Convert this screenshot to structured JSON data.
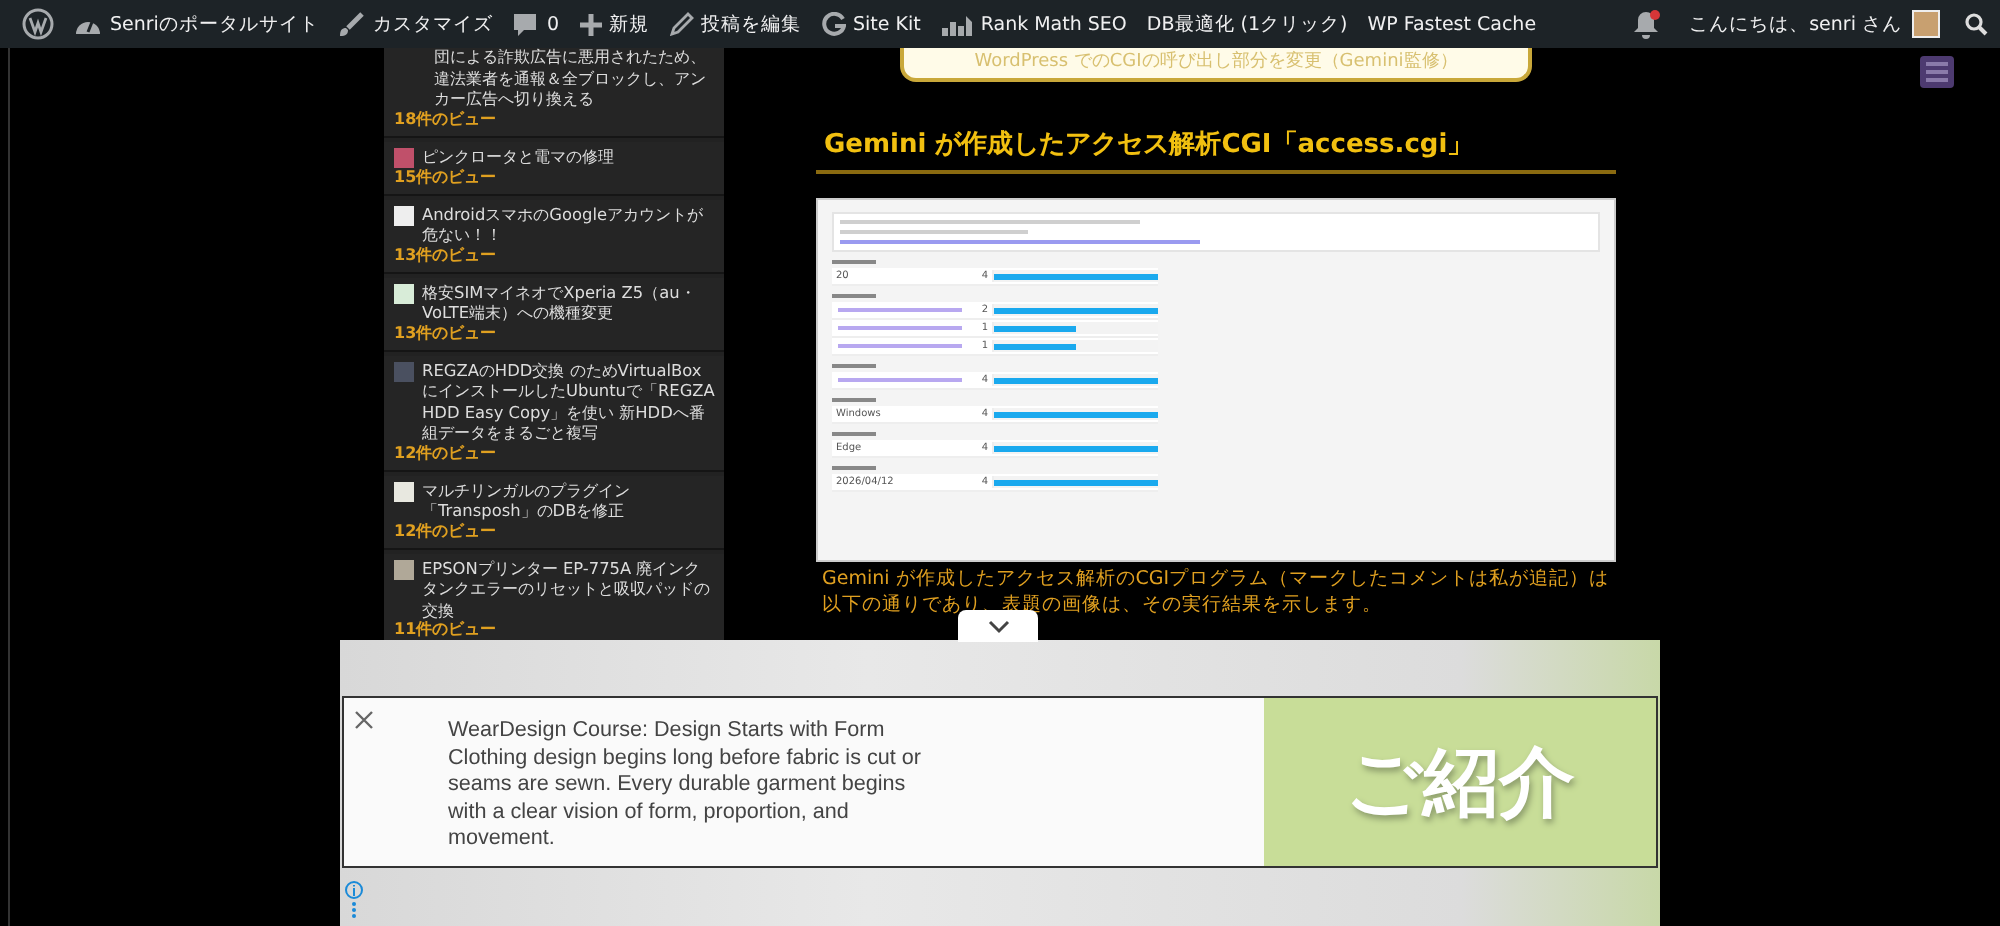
{
  "admin_bar": {
    "items": [
      {
        "kind": "wp"
      },
      {
        "kind": "site",
        "label": "Senriのポータルサイト"
      },
      {
        "kind": "brush",
        "label": "カスタマイズ"
      },
      {
        "kind": "comment",
        "label": "0"
      },
      {
        "kind": "plus",
        "label": "新規"
      },
      {
        "kind": "pencil",
        "label": "投稿を編集"
      },
      {
        "kind": "g",
        "label": "Site Kit"
      },
      {
        "kind": "chart",
        "label": "Rank Math SEO"
      },
      {
        "kind": "none",
        "label": "DB最適化 (1クリック)"
      },
      {
        "kind": "none",
        "label": "WP Fastest Cache"
      }
    ],
    "notification": true,
    "greeting": "こんにちは、senri さん"
  },
  "sidebar": {
    "items": [
      {
        "title": "団による詐欺広告に悪用されたため、違法業者を通報＆全ブロックし、アンカー広告へ切り換える",
        "views": "18件のビュー"
      },
      {
        "title": "ピンクロータと電マの修理",
        "views": "15件のビュー",
        "color": "#c0506a"
      },
      {
        "title": "AndroidスマホのGoogleアカウントが危ない！！",
        "views": "13件のビュー",
        "color": "#eeeeee"
      },
      {
        "title": "格安SIMマイネオでXperia Z5（au・VoLTE端末）への機種変更",
        "views": "13件のビュー",
        "color": "#d8ecd8"
      },
      {
        "title": "REGZAのHDD交換 のためVirtualBoxにインストールしたUbuntuで「REGZA HDD Easy Copy」を使い 新HDDへ番組データをまるごと複写",
        "views": "12件のビュー",
        "color": "#4a5060"
      },
      {
        "title": "マルチリンガルのプラグイン「Transposh」のDBを修正",
        "views": "12件のビュー",
        "color": "#e8e8e0"
      },
      {
        "title": "EPSONプリンター EP-775A 廃インクタンクエラーのリセットと吸収パッドの交換",
        "views": "11件のビュー",
        "color": "#b0a898"
      }
    ]
  },
  "article": {
    "prev_box": "WordPress でのCGIの呼び出し部分を変更（Gemini監修）",
    "heading": "Gemini が作成したアクセス解析CGI「access.cgi」",
    "screenshot": {
      "sections": [
        {
          "rows": [
            {
              "label": "20",
              "count": "4",
              "level": 1
            }
          ]
        },
        {
          "rows": [
            {
              "count": "2",
              "level": 1
            },
            {
              "count": "1",
              "level": 0.5
            },
            {
              "count": "1",
              "level": 0.5
            }
          ]
        },
        {
          "rows": [
            {
              "count": "4",
              "level": 1
            }
          ]
        },
        {
          "rows": [
            {
              "label": "Windows",
              "count": "4",
              "level": 1
            }
          ]
        },
        {
          "rows": [
            {
              "label": "Edge",
              "count": "4",
              "level": 1
            }
          ]
        },
        {
          "rows": [
            {
              "label": "2026/04/12",
              "count": "4",
              "level": 1
            }
          ]
        }
      ]
    },
    "paragraph": "Gemini が作成したアクセス解析のCGIプログラム（マークしたコメントは私が追記）は以下の通りであり、表題の画像は、その実行結果を示します。"
  },
  "ad": {
    "title": "WearDesign Course: Design Starts with Form",
    "body": "Clothing design begins long before fabric is cut or seams are sewn. Every durable garment begins with a clear vision of form, proportion, and movement.",
    "image_text": "ご紹介"
  }
}
